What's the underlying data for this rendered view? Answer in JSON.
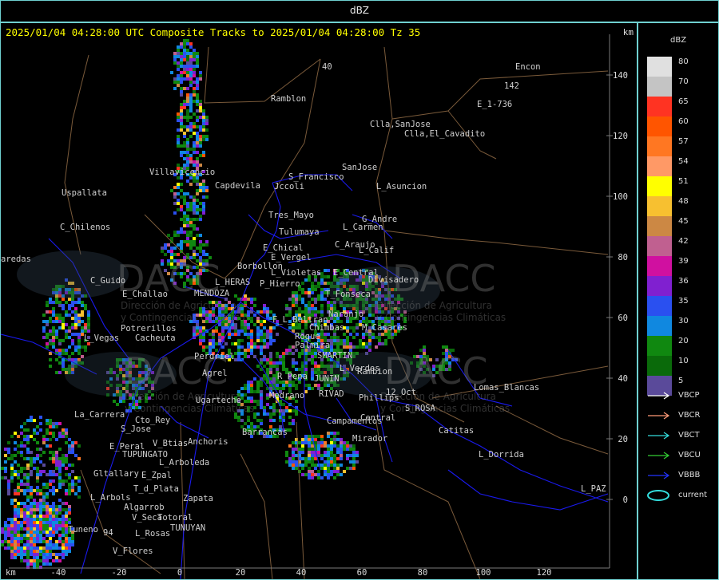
{
  "window": {
    "title": "dBZ"
  },
  "header": {
    "text": "2025/01/04 04:28:00 UTC Composite Tracks to 2025/01/04 04:28:00 Tz 35",
    "unit": "km"
  },
  "legend": {
    "title": "dBZ",
    "scale": [
      {
        "value": "80",
        "color": "#e0e0e0"
      },
      {
        "value": "70",
        "color": "#c4c4c4"
      },
      {
        "value": "65",
        "color": "#ff3322"
      },
      {
        "value": "60",
        "color": "#ff5500"
      },
      {
        "value": "57",
        "color": "#ff7722"
      },
      {
        "value": "54",
        "color": "#ff9966"
      },
      {
        "value": "51",
        "color": "#ffff00"
      },
      {
        "value": "48",
        "color": "#f7c030"
      },
      {
        "value": "45",
        "color": "#cc8844"
      },
      {
        "value": "42",
        "color": "#c06090"
      },
      {
        "value": "39",
        "color": "#d010a0"
      },
      {
        "value": "36",
        "color": "#8020d0"
      },
      {
        "value": "35",
        "color": "#2a50f0"
      },
      {
        "value": "30",
        "color": "#1088e0"
      },
      {
        "value": "20",
        "color": "#108810"
      },
      {
        "value": "10",
        "color": "#0a6a0a"
      },
      {
        "value": "5",
        "color": "#5a4a9a"
      }
    ],
    "tracks": [
      {
        "label": "VBCP",
        "color": "#ffffff"
      },
      {
        "label": "VBCR",
        "color": "#ff9977"
      },
      {
        "label": "VBCT",
        "color": "#33dddd"
      },
      {
        "label": "VBCU",
        "color": "#33cc33"
      },
      {
        "label": "VBBB",
        "color": "#2233ff"
      },
      {
        "label": "current",
        "color": "#33dddd"
      }
    ]
  },
  "axes": {
    "x_unit": "km",
    "x_ticks": [
      "-40",
      "-20",
      "0",
      "20",
      "40",
      "60",
      "80",
      "100",
      "120"
    ],
    "y_ticks": [
      "140",
      "120",
      "100",
      "80",
      "60",
      "40",
      "20",
      "0"
    ]
  },
  "watermark": {
    "brand": "DACC",
    "line1": "Dirección de Agricultura",
    "line2": "y Contingencias Climáticas"
  },
  "places": [
    {
      "name": "Ramblon"
    },
    {
      "name": "Encon"
    },
    {
      "name": "E_1-736"
    },
    {
      "name": "142"
    },
    {
      "name": "Clla,SanJose"
    },
    {
      "name": "Clla,El_Cavadito"
    },
    {
      "name": "SanJose"
    },
    {
      "name": "S_Francisco"
    },
    {
      "name": "Jccoli"
    },
    {
      "name": "L_Asuncion"
    },
    {
      "name": "Uspallata"
    },
    {
      "name": "Villavicencio"
    },
    {
      "name": "Capdevila"
    },
    {
      "name": "Tres_Mayo"
    },
    {
      "name": "G_Andre"
    },
    {
      "name": "Tulumaya"
    },
    {
      "name": "L_Carmen"
    },
    {
      "name": "C_Chilenos"
    },
    {
      "name": "E_Chical"
    },
    {
      "name": "E_Vergel"
    },
    {
      "name": "C_Araujo"
    },
    {
      "name": "L_Calif"
    },
    {
      "name": "Borbollon"
    },
    {
      "name": "L_Violetas"
    },
    {
      "name": "E_Central"
    },
    {
      "name": "Divisadero"
    },
    {
      "name": "L_HERAS"
    },
    {
      "name": "P_Hierro"
    },
    {
      "name": "C_Guido"
    },
    {
      "name": "E_Challao"
    },
    {
      "name": "MENDOZA"
    },
    {
      "name": "T_Fonseca"
    },
    {
      "name": "Naranjo"
    },
    {
      "name": "F_L_Beltran"
    },
    {
      "name": "Chimbas"
    },
    {
      "name": "M_Casares"
    },
    {
      "name": "Potrerillos"
    },
    {
      "name": "L_Vegas"
    },
    {
      "name": "Cacheuta"
    },
    {
      "name": "Roque"
    },
    {
      "name": "Perdriel"
    },
    {
      "name": "Palmira"
    },
    {
      "name": "SMARTIN"
    },
    {
      "name": "Agrel"
    },
    {
      "name": "L_Verdes"
    },
    {
      "name": "Rambion"
    },
    {
      "name": "R_Pena"
    },
    {
      "name": "JUNIN"
    },
    {
      "name": "Lomas_Blancas"
    },
    {
      "name": "Ugarteche"
    },
    {
      "name": "Phillips"
    },
    {
      "name": "RIVAD"
    },
    {
      "name": "12_Oct"
    },
    {
      "name": "Medrano"
    },
    {
      "name": "La_Carrera"
    },
    {
      "name": "S_ROSA"
    },
    {
      "name": "Cto_Rey"
    },
    {
      "name": "Campamentos"
    },
    {
      "name": "Central"
    },
    {
      "name": "S_Jose"
    },
    {
      "name": "Barrancas"
    },
    {
      "name": "Catitas"
    },
    {
      "name": "Anchoris"
    },
    {
      "name": "Mirador"
    },
    {
      "name": "E_Peral"
    },
    {
      "name": "V_Btias"
    },
    {
      "name": "TUPUNGATO"
    },
    {
      "name": "L_Dorrida"
    },
    {
      "name": "L_Arboleda"
    },
    {
      "name": "Gltallary"
    },
    {
      "name": "E_Zpal"
    },
    {
      "name": "L_PAZ"
    },
    {
      "name": "T_d_Plata"
    },
    {
      "name": "L_Arbols"
    },
    {
      "name": "Zapata"
    },
    {
      "name": "Algarrob"
    },
    {
      "name": "Totoral"
    },
    {
      "name": "V_Seca"
    },
    {
      "name": "Tuneno"
    },
    {
      "name": "94"
    },
    {
      "name": "L_Rosas"
    },
    {
      "name": "TUNUYAN"
    },
    {
      "name": "V_Flores"
    },
    {
      "name": "aredas"
    },
    {
      "name": "40"
    }
  ]
}
